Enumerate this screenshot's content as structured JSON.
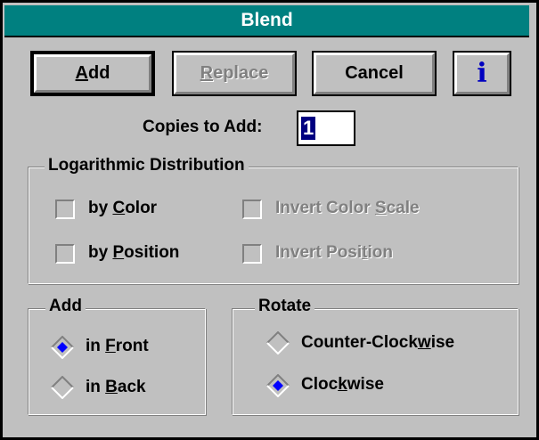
{
  "dialog": {
    "title": "Blend"
  },
  "buttons": {
    "add": {
      "pre": "",
      "key": "A",
      "post": "dd"
    },
    "replace": {
      "pre": "",
      "key": "R",
      "post": "eplace"
    },
    "cancel": {
      "pre": "Cancel",
      "key": "",
      "post": ""
    },
    "info_glyph": "i"
  },
  "copies": {
    "label": "Copies to Add:",
    "value": "1"
  },
  "log_distribution": {
    "title": "Logarithmic Distribution",
    "by_color": {
      "pre": "by ",
      "key": "C",
      "post": "olor",
      "checked": false
    },
    "by_position": {
      "pre": "by ",
      "key": "P",
      "post": "osition",
      "checked": false
    },
    "invert_color_scale": {
      "pre": "Invert Color ",
      "key": "S",
      "post": "cale",
      "checked": false,
      "enabled": false
    },
    "invert_position": {
      "pre": "Invert Posi",
      "key": "t",
      "post": "ion",
      "checked": false,
      "enabled": false
    }
  },
  "add_group": {
    "title": "Add",
    "in_front": {
      "pre": "in ",
      "key": "F",
      "post": "ront",
      "selected": true
    },
    "in_back": {
      "pre": "in ",
      "key": "B",
      "post": "ack",
      "selected": false
    }
  },
  "rotate_group": {
    "title": "Rotate",
    "counter_clockwise": {
      "pre": "Counter-Clock",
      "key": "w",
      "post": "ise",
      "selected": false
    },
    "clockwise": {
      "pre": "Cloc",
      "key": "k",
      "post": "wise",
      "selected": true
    }
  },
  "colors": {
    "titlebar": "#008080",
    "face": "#c0c0c0",
    "info_blue": "#0000c0",
    "radio_dot": "#0000ff",
    "selection": "#000080"
  }
}
